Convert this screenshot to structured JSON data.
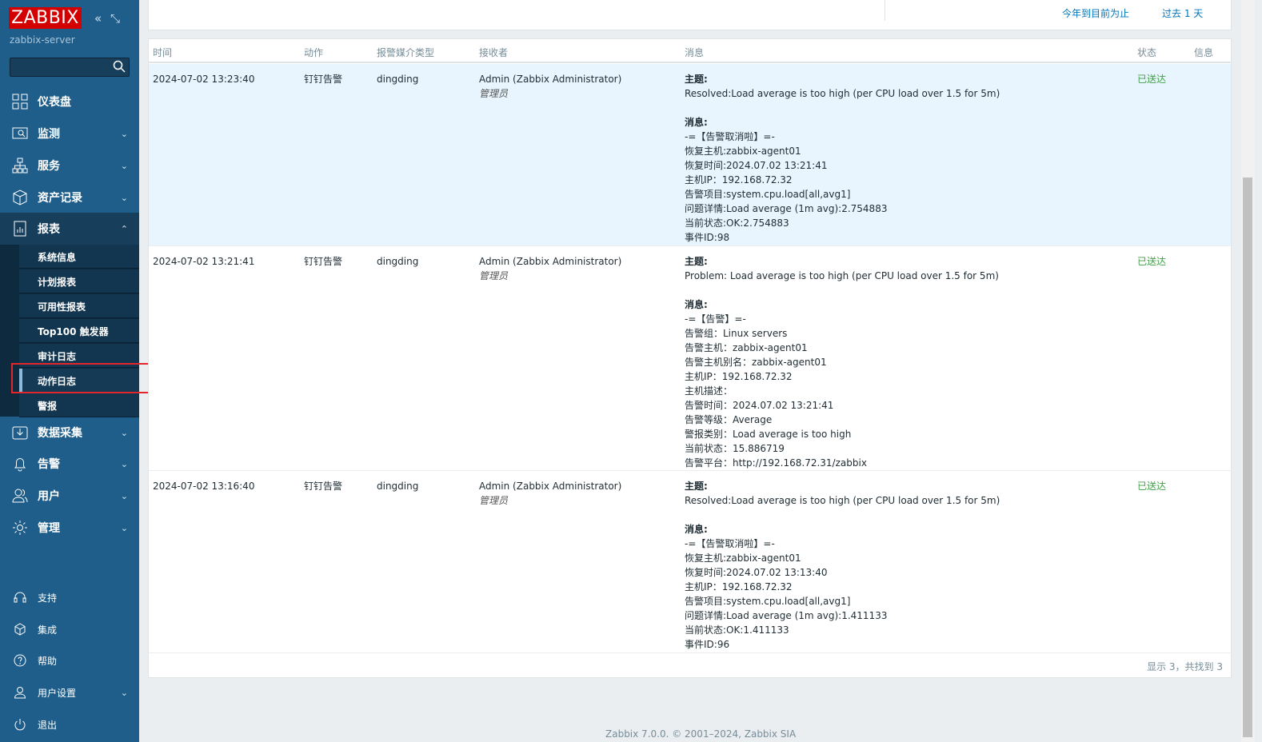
{
  "sidebar": {
    "logo": "ZABBIX",
    "server": "zabbix-server",
    "search_placeholder": "",
    "menu": [
      {
        "label": "仪表盘",
        "icon": "dashboard-icon"
      },
      {
        "label": "监测",
        "icon": "monitoring-icon"
      },
      {
        "label": "服务",
        "icon": "services-icon"
      },
      {
        "label": "资产记录",
        "icon": "inventory-icon"
      },
      {
        "label": "报表",
        "icon": "reports-icon"
      },
      {
        "label": "数据采集",
        "icon": "data-collection-icon"
      },
      {
        "label": "告警",
        "icon": "alerts-icon"
      },
      {
        "label": "用户",
        "icon": "users-icon"
      },
      {
        "label": "管理",
        "icon": "administration-icon"
      }
    ],
    "submenu": [
      "系统信息",
      "计划报表",
      "可用性报表",
      "Top100 触发器",
      "审计日志",
      "动作日志",
      "警报"
    ],
    "bottom": [
      "支持",
      "集成",
      "帮助",
      "用户设置",
      "退出"
    ]
  },
  "topbar": {
    "link1": "今年到目前为止",
    "link2": "过去 1 天"
  },
  "table": {
    "headers": [
      "时间",
      "动作",
      "报警媒介类型",
      "接收者",
      "消息",
      "状态",
      "信息"
    ],
    "rows": [
      {
        "time": "2024-07-02 13:23:40",
        "action": "钉钉告警",
        "media": "dingding",
        "recipient": "Admin (Zabbix Administrator)",
        "role": "管理员",
        "subject_label": "主题:",
        "subject": "Resolved:Load average is too high (per CPU load over 1.5 for 5m)",
        "message_label": "消息:",
        "lines": [
          "-=【告警取消啦】=-",
          "恢复主机:zabbix-agent01",
          "恢复时间:2024.07.02 13:21:41",
          "主机IP：192.168.72.32",
          "告警项目:system.cpu.load[all,avg1]",
          "问题详情:Load average (1m avg):2.754883",
          "当前状态:OK:2.754883",
          "事件ID:98"
        ],
        "status": "已送达"
      },
      {
        "time": "2024-07-02 13:21:41",
        "action": "钉钉告警",
        "media": "dingding",
        "recipient": "Admin (Zabbix Administrator)",
        "role": "管理员",
        "subject_label": "主题:",
        "subject": "Problem: Load average is too high (per CPU load over 1.5 for 5m)",
        "message_label": "消息:",
        "lines": [
          "-=【告警】=-",
          "告警组：Linux servers",
          "告警主机：zabbix-agent01",
          "告警主机别名：zabbix-agent01",
          "主机IP：192.168.72.32",
          "主机描述：",
          "告警时间：2024.07.02 13:21:41",
          "告警等级：Average",
          "警报类别：Load average is too high",
          "当前状态：15.886719",
          "告警平台：http://192.168.72.31/zabbix"
        ],
        "status": "已送达"
      },
      {
        "time": "2024-07-02 13:16:40",
        "action": "钉钉告警",
        "media": "dingding",
        "recipient": "Admin (Zabbix Administrator)",
        "role": "管理员",
        "subject_label": "主题:",
        "subject": "Resolved:Load average is too high (per CPU load over 1.5 for 5m)",
        "message_label": "消息:",
        "lines": [
          "-=【告警取消啦】=-",
          "恢复主机:zabbix-agent01",
          "恢复时间:2024.07.02 13:13:40",
          "主机IP：192.168.72.32",
          "告警项目:system.cpu.load[all,avg1]",
          "问题详情:Load average (1m avg):1.411133",
          "当前状态:OK:1.411133",
          "事件ID:96"
        ],
        "status": "已送达"
      }
    ],
    "footer": "显示 3，共找到 3"
  },
  "copyright": "Zabbix 7.0.0. © 2001–2024, Zabbix SIA"
}
